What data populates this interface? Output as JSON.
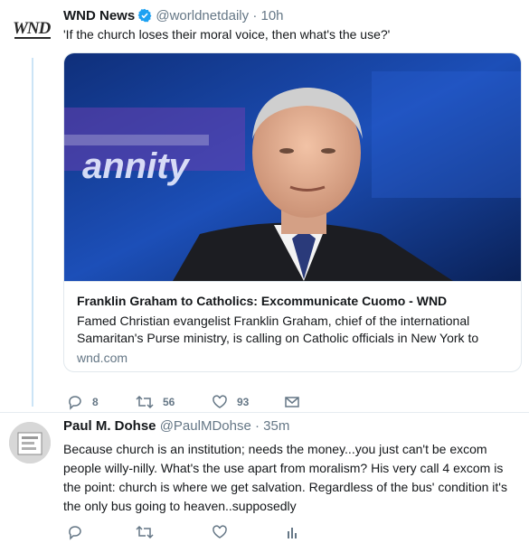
{
  "tweet1": {
    "name": "WND News",
    "handle": "@worldnetdaily",
    "dot": "·",
    "time": "10h",
    "text": "'If the church loses their moral voice, then what's the use?'",
    "logo_text": "WND",
    "card": {
      "image_overlay_text": "annity",
      "title": "Franklin Graham to Catholics: Excommunicate Cuomo - WND",
      "description": "Famed Christian evangelist Franklin Graham, chief of the international Samaritan's Purse ministry, is calling on Catholic officials in New York to",
      "domain": "wnd.com"
    },
    "actions": {
      "replies": "8",
      "retweets": "56",
      "likes": "93"
    }
  },
  "tweet2": {
    "name": "Paul M. Dohse",
    "handle": "@PaulMDohse",
    "dot": "·",
    "time": "35m",
    "text": "Because church is an institution; needs the money...you just can't be excom people willy-nilly. What's the use apart from moralism? His very call 4 excom is the point: church is where we get salvation. Regardless of the bus' condition it's the only bus going to heaven..supposedly"
  },
  "icons": [
    "verified-icon",
    "reply-icon",
    "retweet-icon",
    "like-icon",
    "message-icon",
    "analytics-icon"
  ],
  "colors": {
    "verified": "#1da1f2",
    "muted": "#657786",
    "thread": "#cce4f6",
    "accent": "#14171a"
  }
}
